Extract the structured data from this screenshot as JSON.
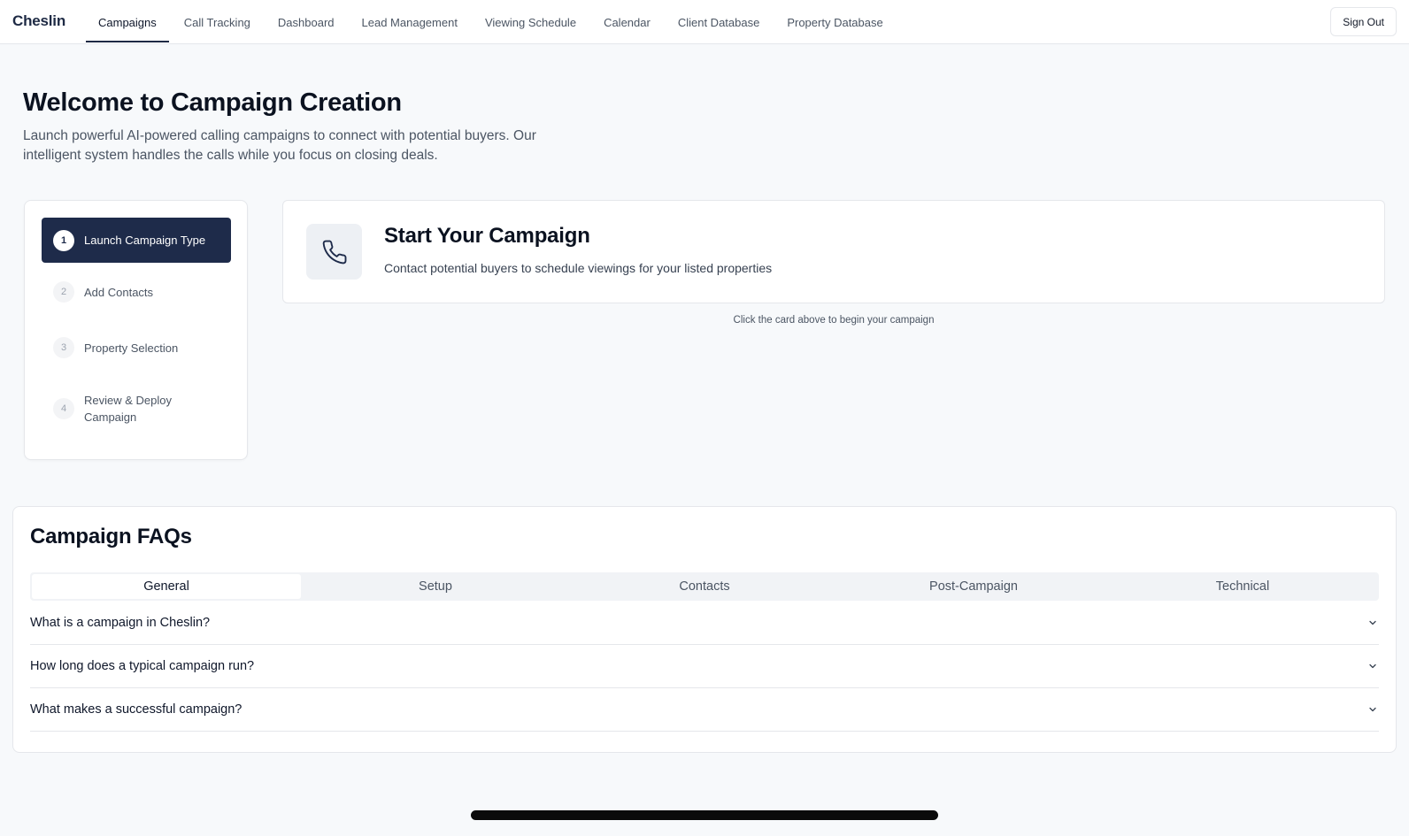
{
  "brand": "Cheslin",
  "nav": {
    "items": [
      {
        "label": "Campaigns"
      },
      {
        "label": "Call Tracking"
      },
      {
        "label": "Dashboard"
      },
      {
        "label": "Lead Management"
      },
      {
        "label": "Viewing Schedule"
      },
      {
        "label": "Calendar"
      },
      {
        "label": "Client Database"
      },
      {
        "label": "Property Database"
      }
    ],
    "active": "Campaigns",
    "sign_out": "Sign Out"
  },
  "hero": {
    "title": "Welcome to Campaign Creation",
    "subtitle": "Launch powerful AI-powered calling campaigns to connect with potential buyers. Our intelligent system handles the calls while you focus on closing deals."
  },
  "steps": [
    {
      "num": "1",
      "label": "Launch Campaign Type",
      "active": true
    },
    {
      "num": "2",
      "label": "Add Contacts",
      "active": false
    },
    {
      "num": "3",
      "label": "Property Selection",
      "active": false
    },
    {
      "num": "4",
      "label": "Review & Deploy Campaign",
      "active": false
    }
  ],
  "campaign_card": {
    "icon": "phone-icon",
    "title": "Start Your Campaign",
    "subtitle": "Contact potential buyers to schedule viewings for your listed properties",
    "hint": "Click the card above to begin your campaign"
  },
  "faq": {
    "title": "Campaign FAQs",
    "tabs": [
      {
        "label": "General"
      },
      {
        "label": "Setup"
      },
      {
        "label": "Contacts"
      },
      {
        "label": "Post-Campaign"
      },
      {
        "label": "Technical"
      }
    ],
    "active_tab": "General",
    "questions": [
      {
        "q": "What is a campaign in Cheslin?"
      },
      {
        "q": "How long does a typical campaign run?"
      },
      {
        "q": "What makes a successful campaign?"
      }
    ]
  },
  "colors": {
    "primary": "#1e2b4a",
    "background": "#f7f9fb",
    "border": "#e5e7eb"
  }
}
